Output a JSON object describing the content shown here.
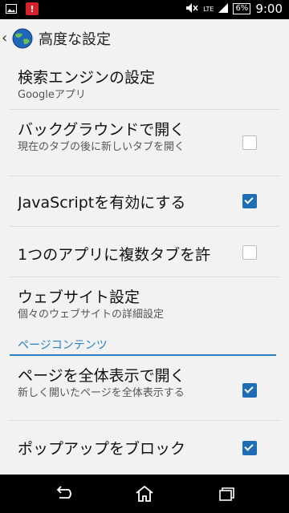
{
  "status_bar": {
    "lte_label": "LTE",
    "battery_label": "6%",
    "time": "9:00",
    "warning_glyph": "!"
  },
  "action_bar": {
    "title": "高度な設定"
  },
  "settings": {
    "search_engine_title": "検索エンジンの設定",
    "search_engine_value": "Googleアプリ",
    "background_tabs_title": "バックグラウンドで開く",
    "background_tabs_summary": "現在のタブの後に新しいタブを開く",
    "background_tabs_checked": false,
    "javascript_title": "JavaScriptを有効にする",
    "javascript_checked": true,
    "multi_tabs_title": "1つのアプリに複数タブを許",
    "multi_tabs_checked": false,
    "website_settings_title": "ウェブサイト設定",
    "website_settings_summary": "個々のウェブサイトの詳細設定"
  },
  "section": {
    "page_content_label": "ページコンテンツ"
  },
  "content": {
    "overview_title": "ページを全体表示で開く",
    "overview_summary": "新しく開いたページを全体表示する",
    "overview_checked": true,
    "block_popups_title": "ポップアップをブロック",
    "block_popups_checked": true
  },
  "colors": {
    "accent": "#2b7fc3",
    "checkbox_on": "#1e6eb5"
  }
}
